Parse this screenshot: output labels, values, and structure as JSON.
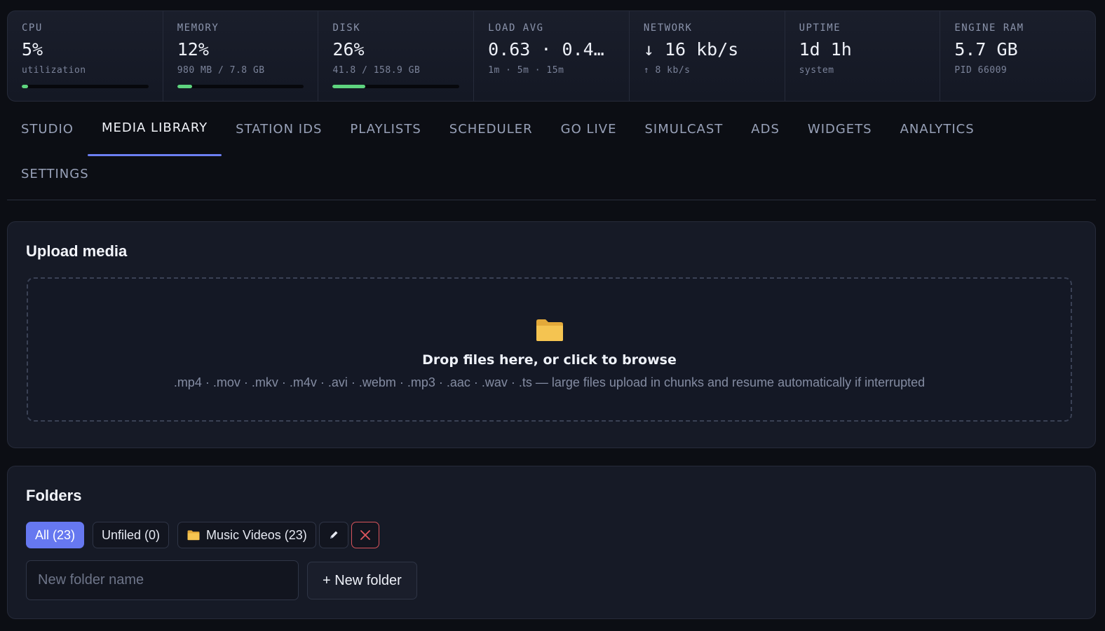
{
  "stats": [
    {
      "label": "CPU",
      "value": "5%",
      "sub": "utilization",
      "bar_fraction": 0.05,
      "bar_color": "#5ed47f"
    },
    {
      "label": "MEMORY",
      "value": "12%",
      "sub": "980 MB / 7.8 GB",
      "bar_fraction": 0.12,
      "bar_color": "#5ed47f"
    },
    {
      "label": "DISK",
      "value": "26%",
      "sub": "41.8 / 158.9 GB",
      "bar_fraction": 0.26,
      "bar_color": "#5ed47f"
    },
    {
      "label": "LOAD AVG",
      "value": "0.63 · 0.4…",
      "sub": "1m · 5m · 15m"
    },
    {
      "label": "NETWORK",
      "value": "↓ 16 kb/s",
      "sub": "↑ 8 kb/s"
    },
    {
      "label": "UPTIME",
      "value": "1d 1h",
      "sub": "system"
    },
    {
      "label": "ENGINE RAM",
      "value": "5.7 GB",
      "sub": "PID 66009"
    }
  ],
  "tabs": [
    {
      "label": "STUDIO",
      "active": false
    },
    {
      "label": "MEDIA LIBRARY",
      "active": true
    },
    {
      "label": "STATION IDS",
      "active": false
    },
    {
      "label": "PLAYLISTS",
      "active": false
    },
    {
      "label": "SCHEDULER",
      "active": false
    },
    {
      "label": "GO LIVE",
      "active": false
    },
    {
      "label": "SIMULCAST",
      "active": false
    },
    {
      "label": "ADS",
      "active": false
    },
    {
      "label": "WIDGETS",
      "active": false
    },
    {
      "label": "ANALYTICS",
      "active": false
    },
    {
      "label": "SETTINGS",
      "active": false
    }
  ],
  "upload": {
    "title": "Upload media",
    "drop_title": "Drop files here, or click to browse",
    "drop_sub": ".mp4 · .mov · .mkv · .m4v · .avi · .webm · .mp3 · .aac · .wav · .ts — large files upload in chunks and resume automatically if interrupted",
    "icon": "folder-icon"
  },
  "folders": {
    "title": "Folders",
    "chip_all": "All (23)",
    "chip_unfiled": "Unfiled (0)",
    "folder_chip": "Music Videos (23)",
    "edit_icon": "pencil-icon",
    "delete_icon": "close-icon",
    "new_folder_placeholder": "New folder name",
    "new_folder_button": "+ New folder"
  },
  "colors": {
    "accent": "#6c7ff2",
    "bar_fill": "#5ed47f",
    "danger": "#d9545c",
    "folder": "#f5c451"
  }
}
